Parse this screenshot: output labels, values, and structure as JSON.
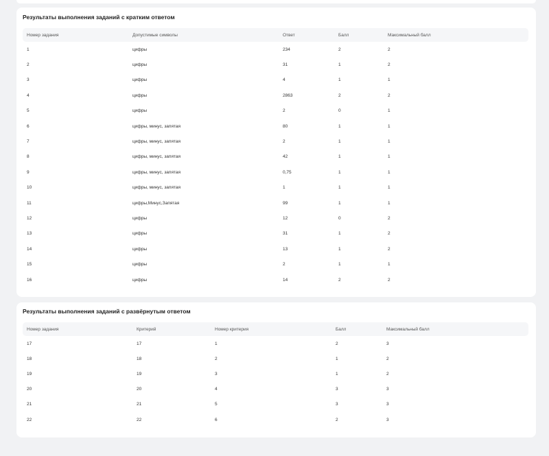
{
  "short": {
    "title": "Результаты выполнения заданий с кратким ответом",
    "headers": [
      "Номер задания",
      "Допустимые символы",
      "Ответ",
      "Балл",
      "Максимальный балл"
    ],
    "rows": [
      [
        "1",
        "цифры",
        "234",
        "2",
        "2"
      ],
      [
        "2",
        "цифры",
        "31",
        "1",
        "2"
      ],
      [
        "3",
        "цифры",
        "4",
        "1",
        "1"
      ],
      [
        "4",
        "цифры",
        "2863",
        "2",
        "2"
      ],
      [
        "5",
        "цифры",
        "2",
        "0",
        "1"
      ],
      [
        "6",
        "цифры, минус, запятая",
        "80",
        "1",
        "1"
      ],
      [
        "7",
        "цифры, минус, запятая",
        "2",
        "1",
        "1"
      ],
      [
        "8",
        "цифры, минус, запятая",
        "42",
        "1",
        "1"
      ],
      [
        "9",
        "цифры, минус, запятая",
        "0,75",
        "1",
        "1"
      ],
      [
        "10",
        "цифры, минус, запятая",
        "1",
        "1",
        "1"
      ],
      [
        "11",
        "цифры,Минус,Запятая",
        "99",
        "1",
        "1"
      ],
      [
        "12",
        "цифры",
        "12",
        "0",
        "2"
      ],
      [
        "13",
        "цифры",
        "31",
        "1",
        "2"
      ],
      [
        "14",
        "цифры",
        "13",
        "1",
        "2"
      ],
      [
        "15",
        "цифры",
        "2",
        "1",
        "1"
      ],
      [
        "16",
        "цифры",
        "14",
        "2",
        "2"
      ]
    ]
  },
  "long": {
    "title": "Результаты выполнения заданий с развёрнутым ответом",
    "headers": [
      "Номер задания",
      "Критерий",
      "Номер критерия",
      "Балл",
      "Максимальный балл"
    ],
    "rows": [
      [
        "17",
        "17",
        "1",
        "2",
        "3"
      ],
      [
        "18",
        "18",
        "2",
        "1",
        "2"
      ],
      [
        "19",
        "19",
        "3",
        "1",
        "2"
      ],
      [
        "20",
        "20",
        "4",
        "3",
        "3"
      ],
      [
        "21",
        "21",
        "5",
        "3",
        "3"
      ],
      [
        "22",
        "22",
        "6",
        "2",
        "3"
      ]
    ]
  }
}
